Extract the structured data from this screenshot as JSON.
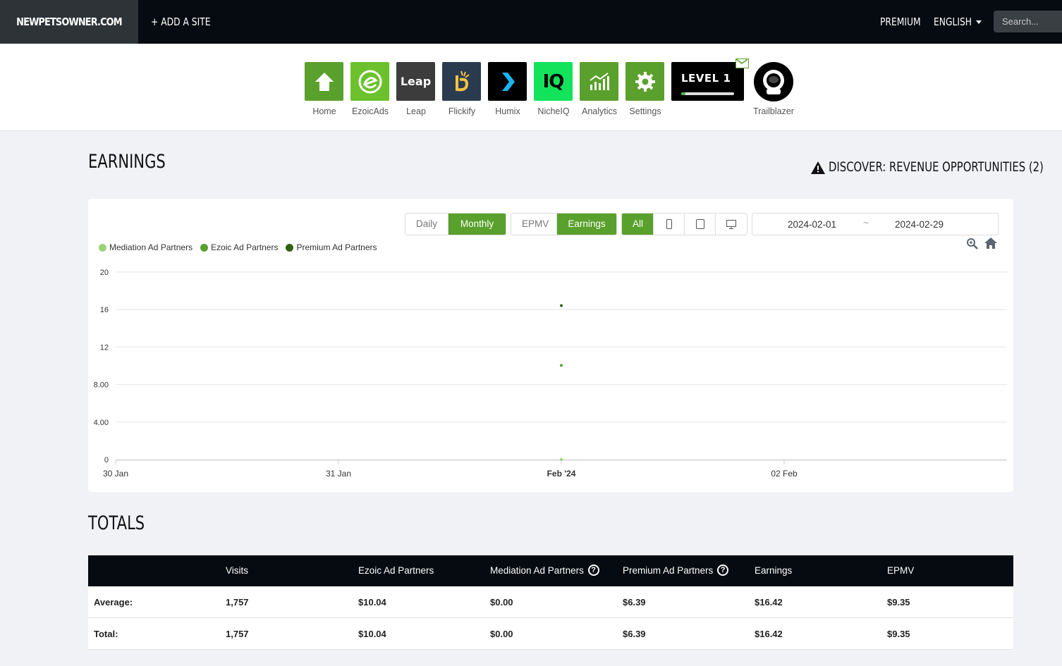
{
  "topbar": {
    "brand": "NEWPETSOWNER.COM",
    "add_site": "+ ADD A SITE",
    "premium": "PREMIUM",
    "language": "ENGLISH",
    "search_placeholder": "Search..."
  },
  "apps": [
    {
      "label": "Home",
      "icon": "home-icon",
      "color": "#5aa02c"
    },
    {
      "label": "EzoicAds",
      "icon": "ezoicads-icon",
      "color": "#6cc12c"
    },
    {
      "label": "Leap",
      "icon": "leap-icon",
      "color": "#3c3c3c",
      "tile_text": "Leap"
    },
    {
      "label": "Flickify",
      "icon": "flickify-icon",
      "color": "#2b3b4f"
    },
    {
      "label": "Humix",
      "icon": "humix-icon",
      "color": "#000000"
    },
    {
      "label": "NicheIQ",
      "icon": "nicheiq-icon",
      "color": "#12e35a",
      "tile_text": "IQ"
    },
    {
      "label": "Analytics",
      "icon": "analytics-icon",
      "color": "#5aa02c"
    },
    {
      "label": "Settings",
      "icon": "gear-icon",
      "color": "#5aa02c"
    }
  ],
  "level": {
    "text": "LEVEL 1",
    "progress": 0.08
  },
  "trailblazer": {
    "label": "Trailblazer"
  },
  "earnings": {
    "title": "EARNINGS",
    "discover": "DISCOVER: REVENUE OPPORTUNITIES (2)",
    "period_buttons": [
      "Daily",
      "Monthly"
    ],
    "period_active": "Monthly",
    "metric_buttons": [
      "EPMV",
      "Earnings"
    ],
    "metric_active": "Earnings",
    "device_all": "All",
    "date_start": "2024-02-01",
    "date_sep": "~",
    "date_end": "2024-02-29"
  },
  "chart_data": {
    "type": "scatter",
    "series": [
      {
        "name": "Mediation Ad Partners",
        "color": "#9bd27a",
        "points": [
          {
            "x": "Feb '24",
            "y": 0
          }
        ]
      },
      {
        "name": "Ezoic Ad Partners",
        "color": "#5aa02c",
        "points": [
          {
            "x": "Feb '24",
            "y": 10.04
          }
        ]
      },
      {
        "name": "Premium Ad Partners",
        "color": "#2f6313",
        "points": [
          {
            "x": "Feb '24",
            "y": 16.42
          }
        ]
      }
    ],
    "x_ticks": [
      "30 Jan",
      "31 Jan",
      "Feb '24",
      "02 Feb"
    ],
    "y_ticks": [
      "0",
      "4.00",
      "8.00",
      "12",
      "16",
      "20"
    ],
    "ylim": [
      0,
      20
    ],
    "grid": true,
    "legend_position": "top-left"
  },
  "totals": {
    "title": "TOTALS",
    "columns": [
      "",
      "Visits",
      "Ezoic Ad Partners",
      "Mediation Ad Partners",
      "Premium Ad Partners",
      "Earnings",
      "EPMV"
    ],
    "rows": [
      [
        "Average:",
        "1,757",
        "$10.04",
        "$0.00",
        "$6.39",
        "$16.42",
        "$9.35"
      ],
      [
        "Total:",
        "1,757",
        "$10.04",
        "$0.00",
        "$6.39",
        "$16.42",
        "$9.35"
      ]
    ]
  }
}
